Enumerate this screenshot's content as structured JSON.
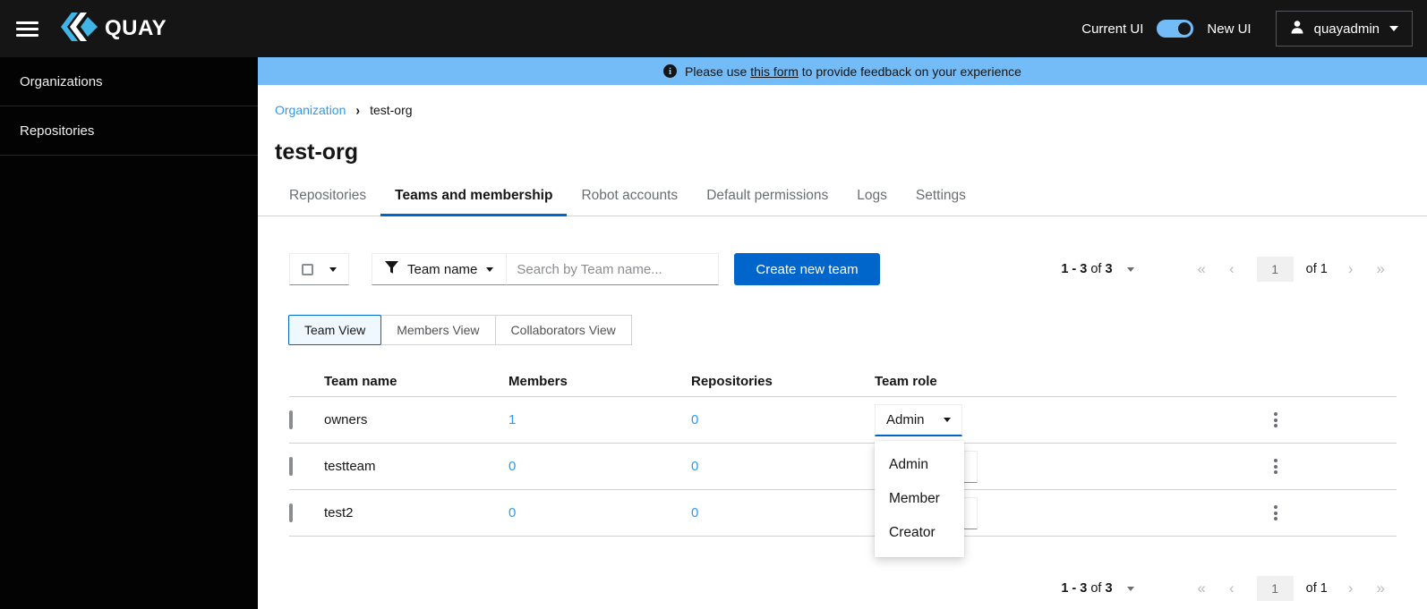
{
  "header": {
    "logo": "QUAY",
    "ui_toggle": {
      "left": "Current UI",
      "right": "New UI"
    },
    "user": "quayadmin"
  },
  "sidebar": {
    "items": [
      {
        "label": "Organizations"
      },
      {
        "label": "Repositories"
      }
    ]
  },
  "banner": {
    "prefix": "Please use",
    "link": "this form",
    "suffix": "to provide feedback on your experience"
  },
  "breadcrumb": {
    "root": "Organization",
    "current": "test-org"
  },
  "page": {
    "title": "test-org"
  },
  "tabs": [
    {
      "label": "Repositories"
    },
    {
      "label": "Teams and membership"
    },
    {
      "label": "Robot accounts"
    },
    {
      "label": "Default permissions"
    },
    {
      "label": "Logs"
    },
    {
      "label": "Settings"
    }
  ],
  "toolbar": {
    "filter_label": "Team name",
    "search_placeholder": "Search by Team name...",
    "create_button": "Create new team"
  },
  "pagination": {
    "range": "1 - 3",
    "of_word": "of",
    "total": "3",
    "first": "«",
    "prev": "‹",
    "page": "1",
    "of_pages": "of 1",
    "next": "›",
    "last": "»"
  },
  "views": [
    {
      "label": "Team View"
    },
    {
      "label": "Members View"
    },
    {
      "label": "Collaborators View"
    }
  ],
  "table": {
    "columns": {
      "name": "Team name",
      "members": "Members",
      "repositories": "Repositories",
      "role": "Team role"
    },
    "rows": [
      {
        "name": "owners",
        "members": "1",
        "repositories": "0",
        "role": "Admin"
      },
      {
        "name": "testteam",
        "members": "0",
        "repositories": "0"
      },
      {
        "name": "test2",
        "members": "0",
        "repositories": "0"
      }
    ]
  },
  "role_menu": {
    "options": [
      {
        "label": "Admin"
      },
      {
        "label": "Member"
      },
      {
        "label": "Creator"
      }
    ]
  },
  "colors": {
    "accent": "#0066cc",
    "banner": "#73bcf7",
    "link": "#2b9af3"
  }
}
